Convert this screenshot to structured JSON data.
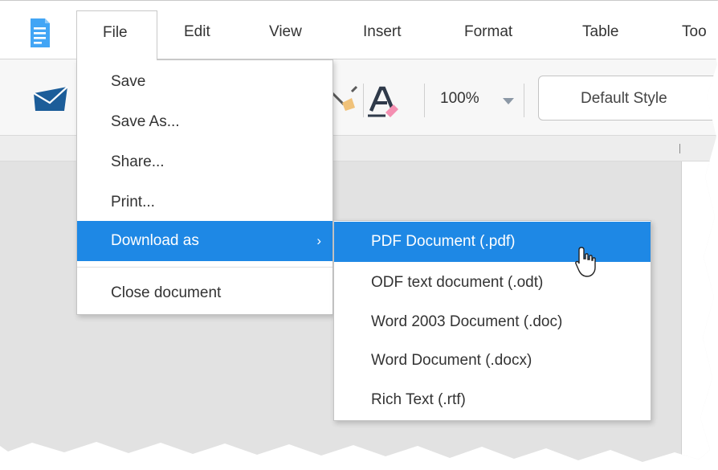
{
  "menubar": {
    "items": [
      {
        "label": "File"
      },
      {
        "label": "Edit"
      },
      {
        "label": "View"
      },
      {
        "label": "Insert"
      },
      {
        "label": "Format"
      },
      {
        "label": "Table"
      },
      {
        "label": "Too"
      }
    ],
    "active_item": "File"
  },
  "toolbar": {
    "zoom": "100%",
    "paragraph_style": "Default Style"
  },
  "file_menu": {
    "items": [
      {
        "label": "Save"
      },
      {
        "label": "Save As..."
      },
      {
        "label": "Share..."
      },
      {
        "label": "Print..."
      },
      {
        "label": "Download as",
        "submenu_arrow": "›",
        "highlighted": true
      },
      {
        "label": "Close document"
      }
    ]
  },
  "download_submenu": {
    "items": [
      {
        "label": "PDF Document (.pdf)",
        "highlighted": true
      },
      {
        "label": "ODF text document (.odt)"
      },
      {
        "label": "Word 2003 Document (.doc)"
      },
      {
        "label": "Word Document (.docx)"
      },
      {
        "label": "Rich Text (.rtf)"
      }
    ]
  },
  "colors": {
    "accent": "#1e88e5",
    "app_icon": "#42a5f5",
    "mail_icon": "#1c5d99"
  },
  "icons": {
    "app": "document-icon",
    "mail": "mail-icon",
    "format_painter": "format-painter-icon",
    "clear_format": "clear-format-icon",
    "cursor": "pointer-cursor-icon"
  }
}
